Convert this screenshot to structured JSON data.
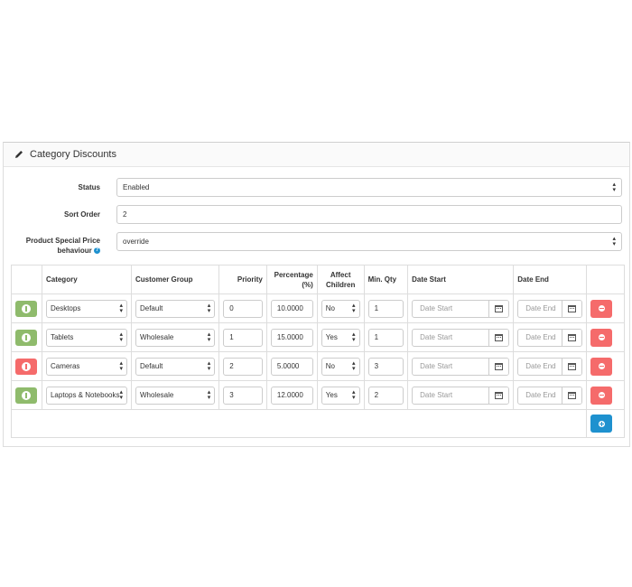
{
  "panel": {
    "title": "Category Discounts",
    "icon": "pencil-icon"
  },
  "form": {
    "status": {
      "label": "Status",
      "value": "Enabled"
    },
    "sort_order": {
      "label": "Sort Order",
      "value": "2"
    },
    "special_price": {
      "label_line1": "Product Special Price",
      "label_line2": "behaviour",
      "value": "override"
    }
  },
  "table": {
    "headers": {
      "category": "Category",
      "customer_group": "Customer Group",
      "priority": "Priority",
      "percentage_1": "Percentage",
      "percentage_2": "(%)",
      "affect_1": "Affect",
      "affect_2": "Children",
      "min_qty": "Min. Qty",
      "date_start": "Date Start",
      "date_end": "Date End"
    },
    "date_start_placeholder": "Date Start",
    "date_end_placeholder": "Date End",
    "rows": [
      {
        "status": "enabled",
        "category": "Desktops",
        "customer_group": "Default",
        "priority": "0",
        "percentage": "10.0000",
        "affect_children": "No",
        "min_qty": "1"
      },
      {
        "status": "enabled",
        "category": "Tablets",
        "customer_group": "Wholesale",
        "priority": "1",
        "percentage": "15.0000",
        "affect_children": "Yes",
        "min_qty": "1"
      },
      {
        "status": "disabled",
        "category": "Cameras",
        "customer_group": "Default",
        "priority": "2",
        "percentage": "5.0000",
        "affect_children": "No",
        "min_qty": "3"
      },
      {
        "status": "enabled",
        "category": "Laptops & Notebooks",
        "customer_group": "Wholesale",
        "priority": "3",
        "percentage": "12.0000",
        "affect_children": "Yes",
        "min_qty": "2"
      }
    ]
  },
  "colors": {
    "enabled": "#8fbb6c",
    "disabled": "#f56b6b",
    "danger": "#f56b6b",
    "primary": "#1e91cf"
  }
}
